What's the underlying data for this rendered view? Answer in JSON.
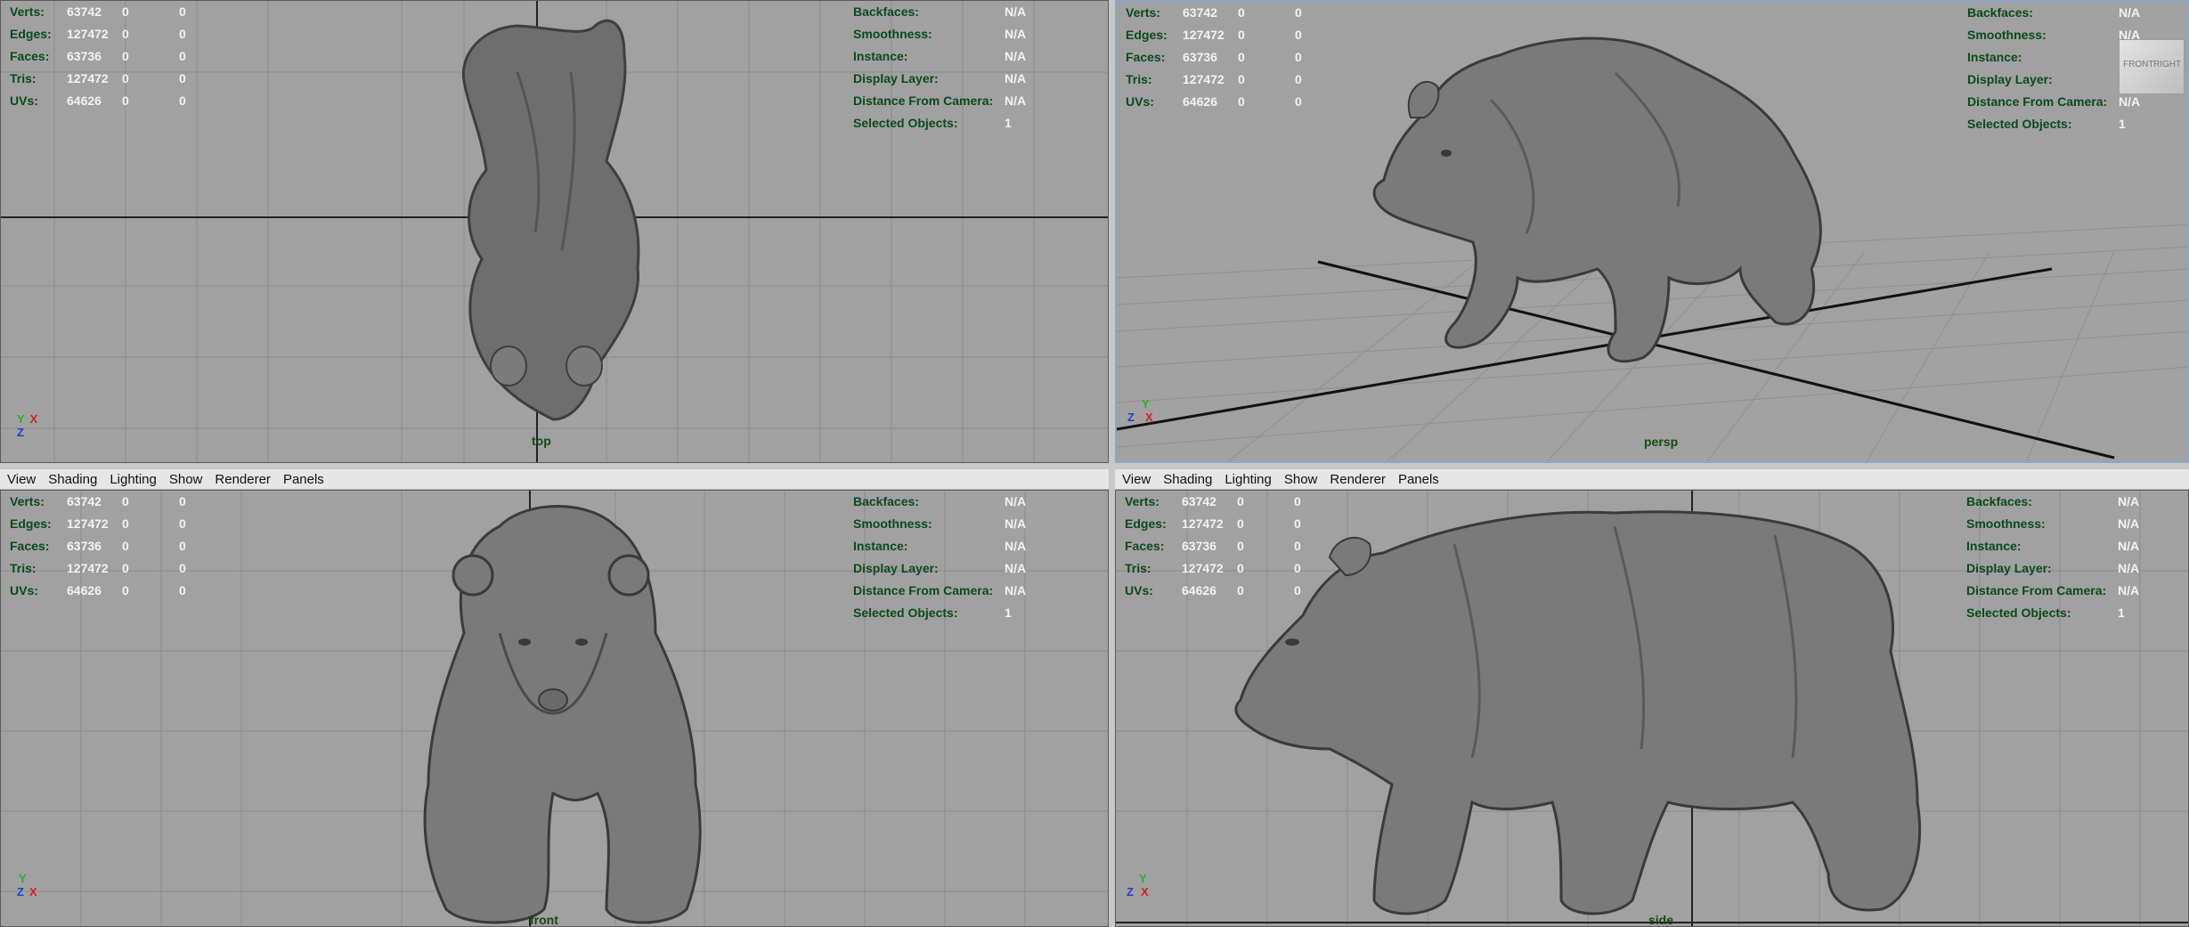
{
  "menu": [
    "View",
    "Shading",
    "Lighting",
    "Show",
    "Renderer",
    "Panels"
  ],
  "hud_left_labels": [
    "Verts:",
    "Edges:",
    "Faces:",
    "Tris:",
    "UVs:"
  ],
  "hud_right_labels": [
    "Backfaces:",
    "Smoothness:",
    "Instance:",
    "Display Layer:",
    "Distance From Camera:",
    "Selected Objects:"
  ],
  "hud_right_values": [
    "N/A",
    "N/A",
    "N/A",
    "N/A",
    "N/A",
    "1"
  ],
  "hud_left_values": [
    [
      "63742",
      "0",
      "0"
    ],
    [
      "127472",
      "0",
      "0"
    ],
    [
      "63736",
      "0",
      "0"
    ],
    [
      "127472",
      "0",
      "0"
    ],
    [
      "64626",
      "0",
      "0"
    ]
  ],
  "hud_left_values_persp": [
    [
      "63742",
      "0",
      "0"
    ],
    [
      "127472",
      "0",
      "0"
    ],
    [
      "63736",
      "0",
      "0"
    ],
    [
      "127472",
      "0",
      "0"
    ],
    [
      "64626",
      "0",
      "0"
    ]
  ],
  "views": {
    "top": {
      "label": "top"
    },
    "persp": {
      "label": "persp"
    },
    "front": {
      "label": "front"
    },
    "side": {
      "label": "side"
    }
  },
  "axes": {
    "x": "X",
    "y": "Y",
    "z": "Z"
  },
  "viewcube": {
    "front": "FRONT",
    "right": "RIGHT"
  },
  "colors": {
    "viewport_bg": "#a1a1a1",
    "grid": "#8a8a8a",
    "axis_line": "#222222",
    "hud_label": "#0a4a1a",
    "hud_value": "#f3f3f3",
    "x_axis": "#d41f1f",
    "y_axis": "#22b422",
    "z_axis": "#2040d0"
  }
}
